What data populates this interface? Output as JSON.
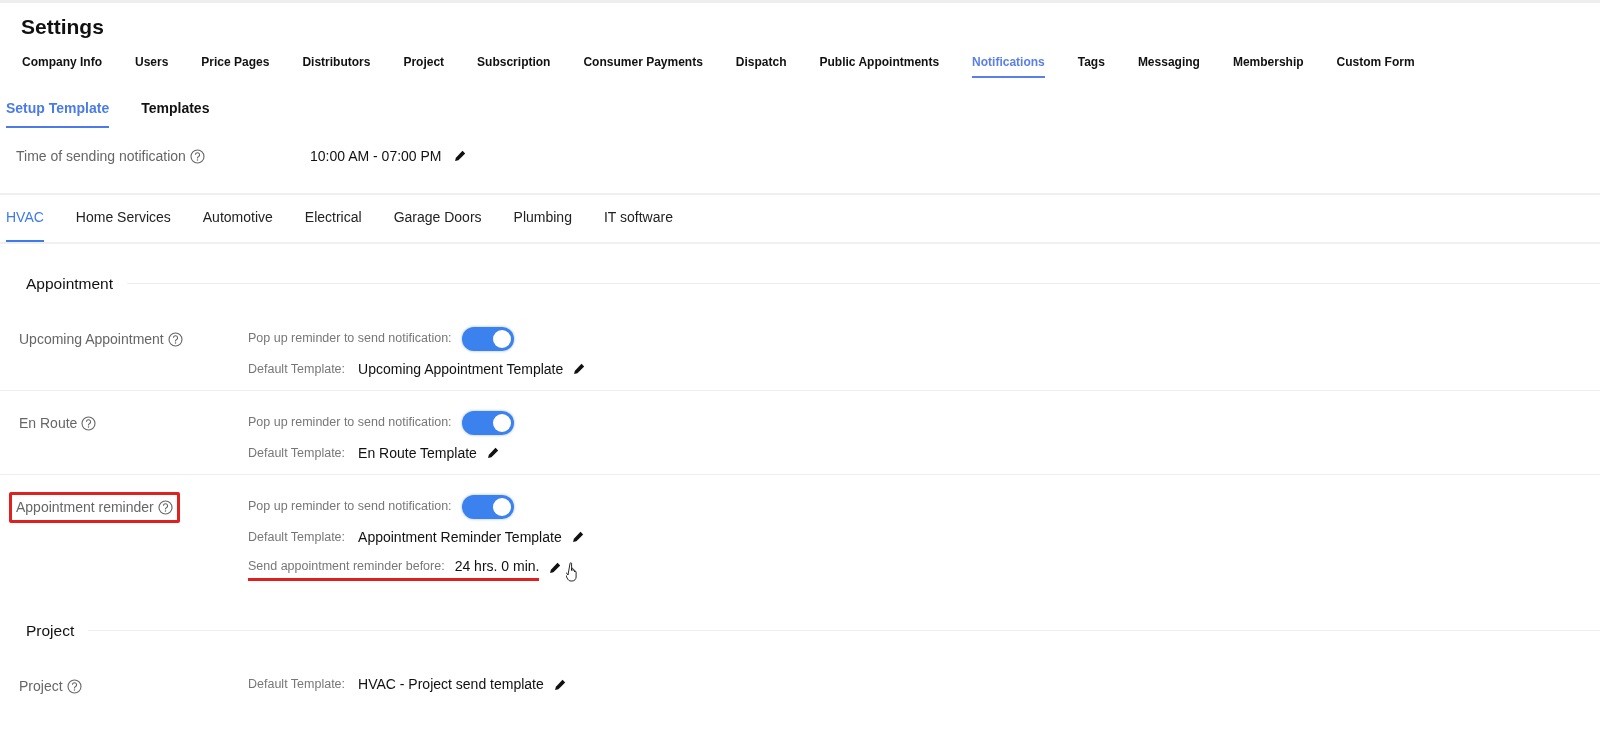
{
  "title": "Settings",
  "main_tabs": [
    {
      "label": "Company Info",
      "selected": false
    },
    {
      "label": "Users",
      "selected": false
    },
    {
      "label": "Price Pages",
      "selected": false
    },
    {
      "label": "Distributors",
      "selected": false
    },
    {
      "label": "Project",
      "selected": false
    },
    {
      "label": "Subscription",
      "selected": false
    },
    {
      "label": "Consumer Payments",
      "selected": false
    },
    {
      "label": "Dispatch",
      "selected": false
    },
    {
      "label": "Public Appointments",
      "selected": false
    },
    {
      "label": "Notifications",
      "selected": true
    },
    {
      "label": "Tags",
      "selected": false
    },
    {
      "label": "Messaging",
      "selected": false
    },
    {
      "label": "Membership",
      "selected": false
    },
    {
      "label": "Custom Form",
      "selected": false
    }
  ],
  "sub_tabs": [
    {
      "label": "Setup Template",
      "selected": true
    },
    {
      "label": "Templates",
      "selected": false
    }
  ],
  "time_setting": {
    "label": "Time of sending notification",
    "value": "10:00 AM - 07:00 PM"
  },
  "industry_tabs": [
    {
      "label": "HVAC",
      "selected": true
    },
    {
      "label": "Home Services",
      "selected": false
    },
    {
      "label": "Automotive",
      "selected": false
    },
    {
      "label": "Electrical",
      "selected": false
    },
    {
      "label": "Garage Doors",
      "selected": false
    },
    {
      "label": "Plumbing",
      "selected": false
    },
    {
      "label": "IT software",
      "selected": false
    }
  ],
  "sections": [
    {
      "title": "Appointment",
      "items": [
        {
          "name": "Upcoming Appointment",
          "highlighted": false,
          "popup_label": "Pop up reminder to send notification:",
          "popup_on": true,
          "template_label": "Default Template:",
          "template": "Upcoming Appointment Template"
        },
        {
          "name": "En Route",
          "highlighted": false,
          "popup_label": "Pop up reminder to send notification:",
          "popup_on": true,
          "template_label": "Default Template:",
          "template": "En Route Template"
        },
        {
          "name": "Appointment reminder",
          "highlighted": true,
          "popup_label": "Pop up reminder to send notification:",
          "popup_on": true,
          "template_label": "Default Template:",
          "template": "Appointment Reminder Template",
          "reminder_label": "Send appointment reminder before:",
          "reminder_value": "24 hrs. 0 min.",
          "underlined": true
        }
      ]
    },
    {
      "title": "Project",
      "items": [
        {
          "name": "Project",
          "highlighted": false,
          "template_label": "Default Template:",
          "template": "HVAC - Project send template"
        }
      ]
    }
  ]
}
